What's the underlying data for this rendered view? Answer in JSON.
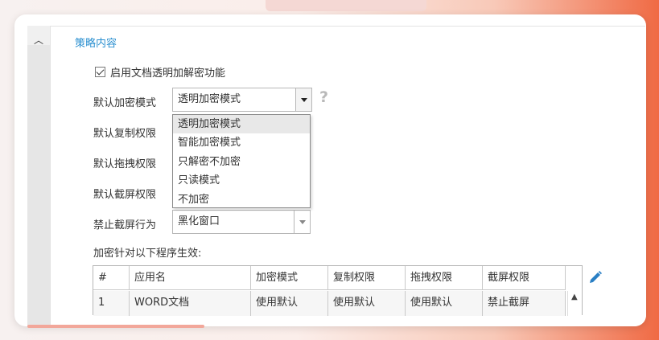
{
  "section_title": "策略内容",
  "enable_encryption": {
    "label": "启用文档透明加解密功能",
    "checked": true
  },
  "fields": {
    "encrypt_mode": {
      "label": "默认加密模式",
      "value": "透明加密模式"
    },
    "copy_perm": {
      "label": "默认复制权限"
    },
    "drag_perm": {
      "label": "默认拖拽权限"
    },
    "screenshot_perm": {
      "label": "默认截屏权限"
    },
    "block_screenshot": {
      "label": "禁止截屏行为",
      "value": "黑化窗口"
    }
  },
  "dropdown_options": [
    "透明加密模式",
    "智能加密模式",
    "只解密不加密",
    "只读模式",
    "不加密"
  ],
  "dropdown_active_index": 0,
  "table_caption": "加密针对以下程序生效:",
  "table": {
    "headers": [
      "#",
      "应用名",
      "加密模式",
      "复制权限",
      "拖拽权限",
      "截屏权限"
    ],
    "rows": [
      [
        "1",
        "WORD文档",
        "使用默认",
        "使用默认",
        "使用默认",
        "禁止截屏"
      ]
    ]
  },
  "icons": {
    "help": "question-mark-icon",
    "edit": "pencil-icon",
    "scroll_up": "chevron-up-icon"
  },
  "colors": {
    "accent": "#2a8fd0",
    "pencil": "#2a7fc4"
  }
}
